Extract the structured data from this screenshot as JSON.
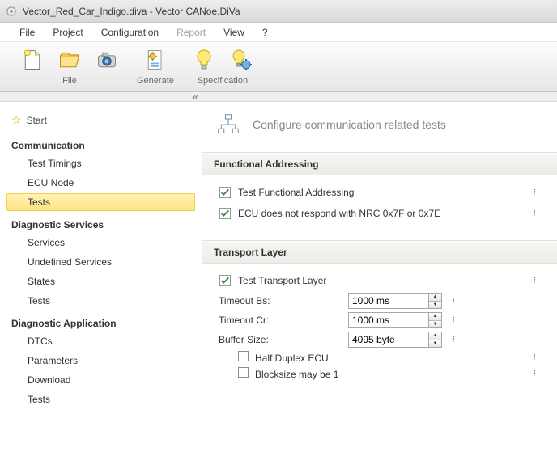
{
  "window": {
    "title": "Vector_Red_Car_Indigo.diva - Vector CANoe.DiVa"
  },
  "menu": {
    "file": "File",
    "project": "Project",
    "configuration": "Configuration",
    "report": "Report",
    "view": "View",
    "help": "?"
  },
  "ribbon": {
    "file_group": "File",
    "generate_group": "Generate",
    "specification_group": "Specification"
  },
  "sidebar": {
    "start": "Start",
    "sec_comm": "Communication",
    "comm": {
      "timings": "Test Timings",
      "ecu": "ECU Node",
      "tests": "Tests"
    },
    "sec_diagserv": "Diagnostic  Services",
    "serv": {
      "services": "Services",
      "undefined": "Undefined Services",
      "states": "States",
      "tests": "Tests"
    },
    "sec_diagapp": "Diagnostic  Application",
    "app": {
      "dtcs": "DTCs",
      "parameters": "Parameters",
      "download": "Download",
      "tests": "Tests"
    }
  },
  "page": {
    "title": "Configure communication related tests",
    "func_addr": {
      "heading": "Functional Addressing",
      "row1": "Test Functional Addressing",
      "row2": "ECU does not respond with NRC 0x7F or 0x7E"
    },
    "transport": {
      "heading": "Transport Layer",
      "row1": "Test Transport Layer",
      "timeout_bs_label": "Timeout Bs:",
      "timeout_bs_value": "1000 ms",
      "timeout_cr_label": "Timeout Cr:",
      "timeout_cr_value": "1000 ms",
      "buffer_label": "Buffer Size:",
      "buffer_value": "4095 byte",
      "half_duplex": "Half Duplex ECU",
      "blocksize": "Blocksize may be 1"
    }
  }
}
